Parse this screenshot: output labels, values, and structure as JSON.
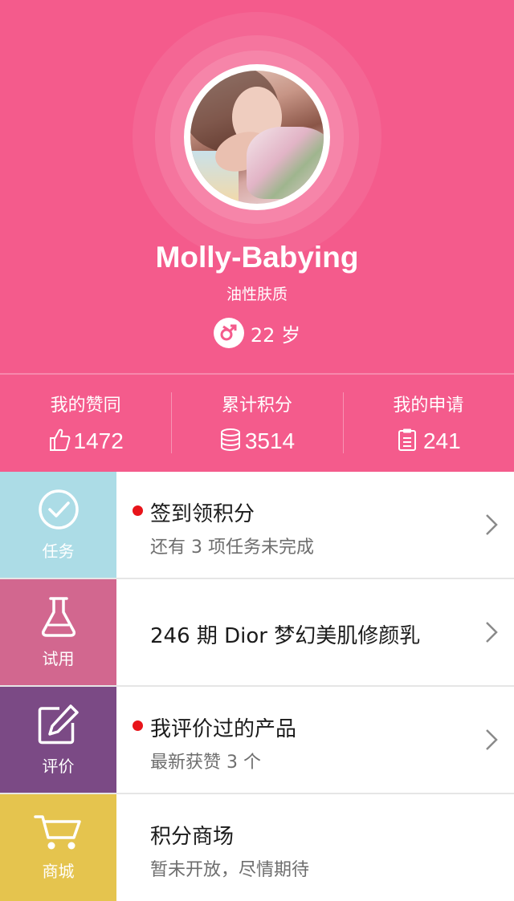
{
  "profile": {
    "name": "Molly-Babying",
    "skin_type": "油性肤质",
    "age": "22 岁"
  },
  "stats": [
    {
      "label": "我的赞同",
      "value": "1472",
      "icon": "thumbs-up-icon"
    },
    {
      "label": "累计积分",
      "value": "3514",
      "icon": "coin-stack-icon"
    },
    {
      "label": "我的申请",
      "value": "241",
      "icon": "clipboard-icon"
    }
  ],
  "menu": [
    {
      "tile_label": "任务",
      "tile_color": "#acdce6",
      "icon": "check-circle-icon",
      "title": "签到领积分",
      "subtitle": "还有 3 项任务未完成",
      "has_dot": true,
      "has_chevron": true
    },
    {
      "tile_label": "试用",
      "tile_color": "#d2678f",
      "icon": "flask-icon",
      "title": "246 期 Dior 梦幻美肌修颜乳",
      "subtitle": "",
      "has_dot": false,
      "has_chevron": true
    },
    {
      "tile_label": "评价",
      "tile_color": "#7b4a85",
      "icon": "edit-icon",
      "title": "我评价过的产品",
      "subtitle": "最新获赞 3 个",
      "has_dot": true,
      "has_chevron": true
    },
    {
      "tile_label": "商城",
      "tile_color": "#e5c44e",
      "icon": "cart-icon",
      "title": "积分商场",
      "subtitle": "暂未开放，尽情期待",
      "has_dot": false,
      "has_chevron": false
    }
  ],
  "colors": {
    "header_pink": "#f45b8c",
    "notification_dot": "#e8141a"
  }
}
